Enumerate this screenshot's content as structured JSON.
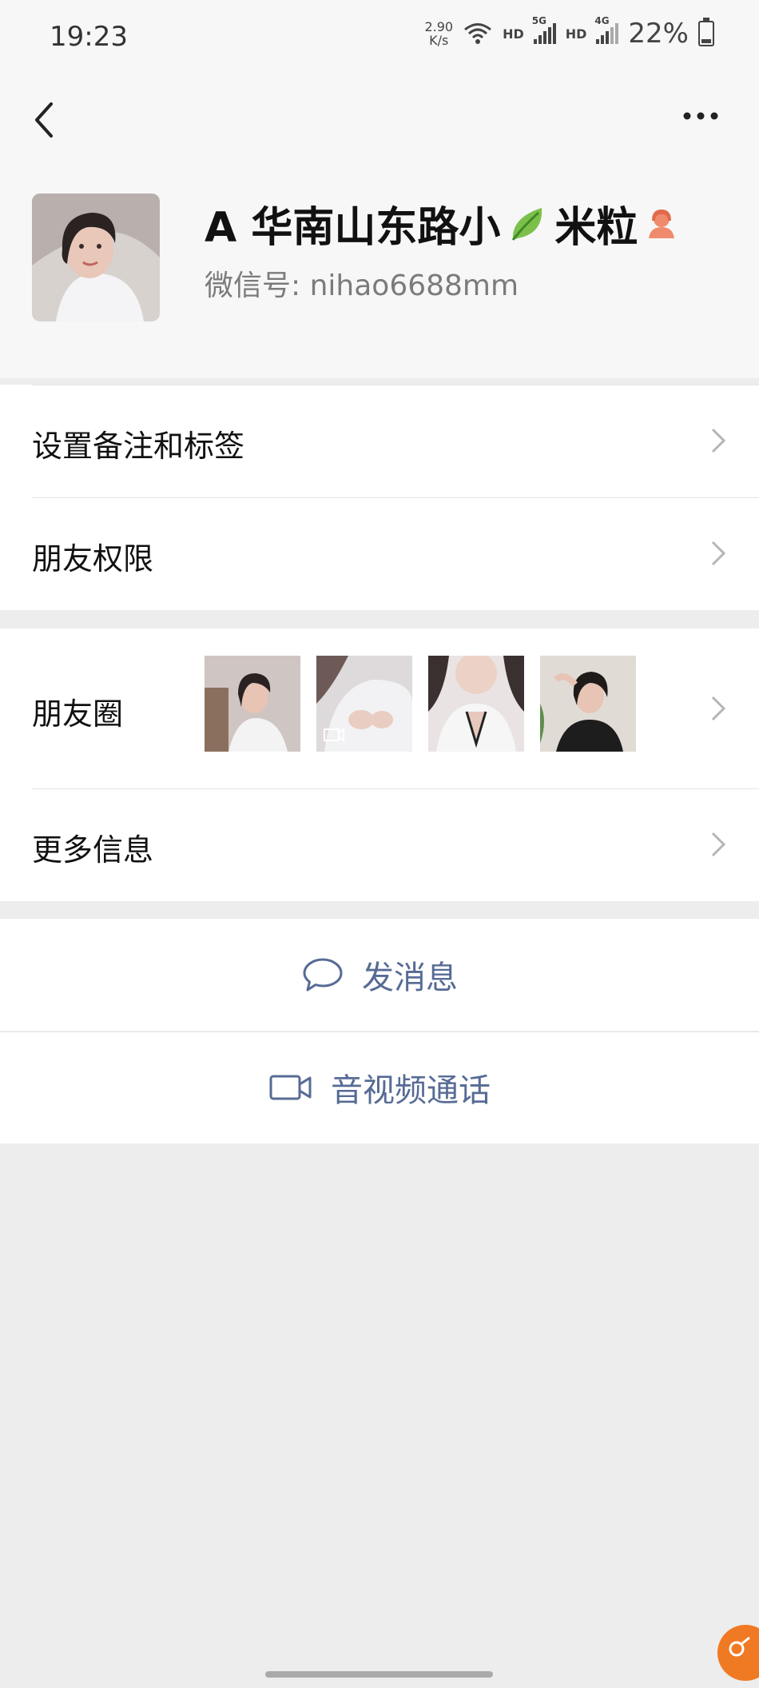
{
  "status_bar": {
    "time": "19:23",
    "speed_value": "2.90",
    "speed_unit": "K/s",
    "net1": "HD",
    "net2_gen": "5G",
    "net3": "HD",
    "net4_gen": "4G",
    "battery": "22%",
    "battery_level": 0.22
  },
  "profile": {
    "name_prefix": "A 华南山东路小",
    "name_suffix": "米粒",
    "wechat_id_label": "微信号:",
    "wechat_id": "nihao6688mm",
    "gender_icon": "female-icon",
    "accent": "#f08a6c"
  },
  "menu": {
    "remark_label": "设置备注和标签",
    "permission_label": "朋友权限",
    "moments_label": "朋友圈",
    "more_info_label": "更多信息"
  },
  "actions": {
    "message_label": "发消息",
    "call_label": "音视频通话",
    "link_color": "#576b95"
  }
}
